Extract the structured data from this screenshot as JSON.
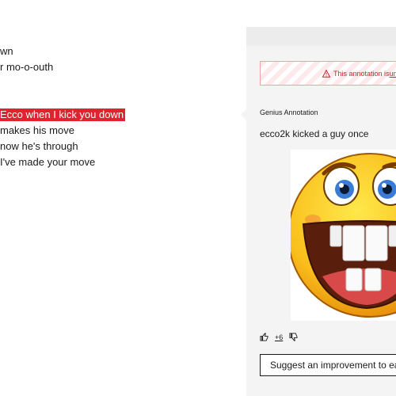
{
  "lyrics": [
    {
      "text": "wn",
      "highlighted": false
    },
    {
      "text": "r mo-o-outh",
      "highlighted": false
    },
    {
      "text": "Ecco when I kick you down",
      "highlighted": true
    },
    {
      "text": "makes his move",
      "highlighted": false
    },
    {
      "text": "now he's through",
      "highlighted": false
    },
    {
      "text": "I've made your move",
      "highlighted": false
    }
  ],
  "annotation": {
    "warning_prefix": "This annotation is ",
    "warning_link": "un",
    "label": "Genius Annotation",
    "text": "ecco2k kicked a guy once",
    "image_alt": "laughing emoji with big teeth",
    "vote_count": "+6"
  },
  "suggest_button": "Suggest an improvement to ea",
  "colors": {
    "highlight": "#e0232f",
    "warning_text": "#d11e2c",
    "panel_bg": "#f4f4f4"
  }
}
